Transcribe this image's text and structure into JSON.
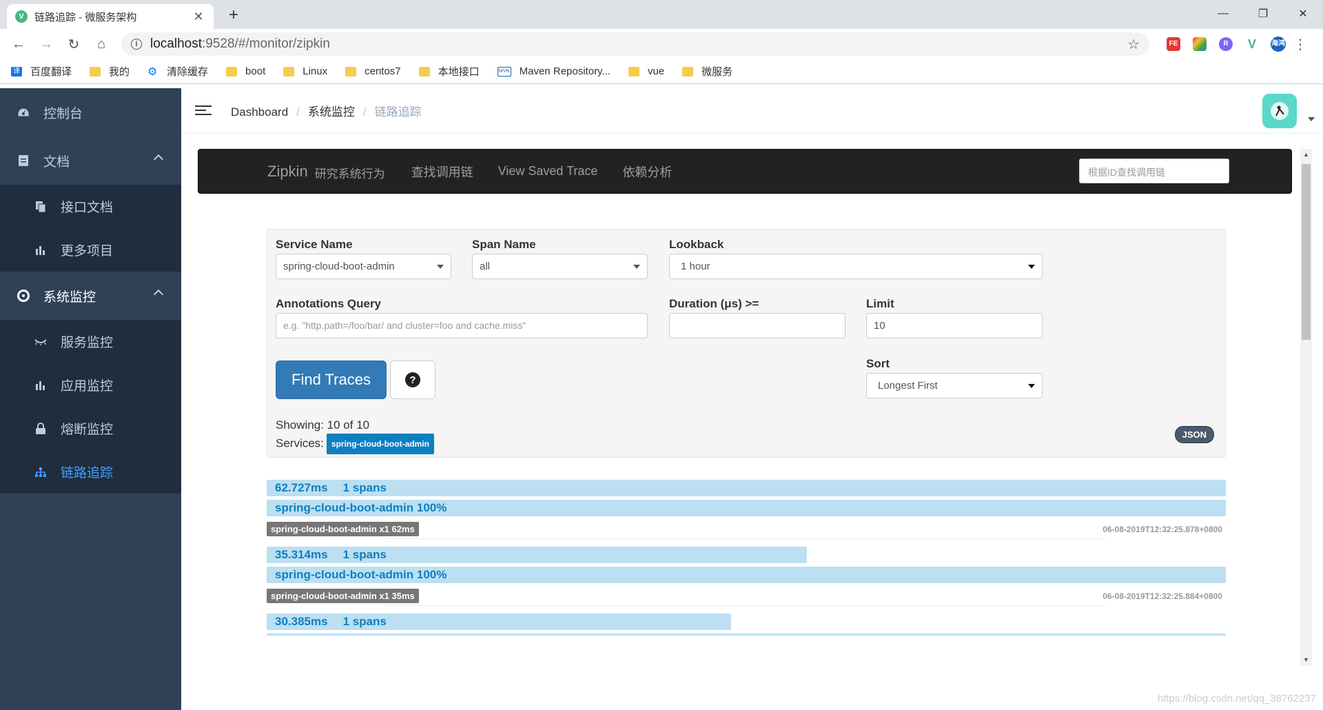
{
  "browser": {
    "tab_title": "链路追踪 - 微服务架构",
    "url_host": "localhost",
    "url_path": ":9528/#/monitor/zipkin",
    "profile": "海鸿",
    "bookmarks": [
      {
        "label": "百度翻译",
        "icon": "translate-icon"
      },
      {
        "label": "我的",
        "icon": "folder-icon"
      },
      {
        "label": "清除缓存",
        "icon": "gear-icon"
      },
      {
        "label": "boot",
        "icon": "folder-icon"
      },
      {
        "label": "Linux",
        "icon": "folder-icon"
      },
      {
        "label": "centos7",
        "icon": "folder-icon"
      },
      {
        "label": "本地接口",
        "icon": "folder-icon"
      },
      {
        "label": "Maven Repository...",
        "icon": "mvn-icon"
      },
      {
        "label": "vue",
        "icon": "folder-icon"
      },
      {
        "label": "微服务",
        "icon": "folder-icon"
      }
    ]
  },
  "sidebar": {
    "items": [
      {
        "label": "控制台",
        "icon": "dashboard-icon"
      },
      {
        "label": "文档",
        "icon": "document-icon",
        "children": [
          {
            "label": "接口文档",
            "icon": "copy-icon"
          },
          {
            "label": "更多项目",
            "icon": "bar-chart-icon"
          }
        ]
      },
      {
        "label": "系统监控",
        "icon": "monitor-icon",
        "children": [
          {
            "label": "服务监控",
            "icon": "eye-icon"
          },
          {
            "label": "应用监控",
            "icon": "bar-chart-icon"
          },
          {
            "label": "熔断监控",
            "icon": "lock-icon"
          },
          {
            "label": "链路追踪",
            "icon": "tree-icon",
            "active": true
          }
        ]
      }
    ]
  },
  "breadcrumb": [
    "Dashboard",
    "系统监控",
    "链路追踪"
  ],
  "zipkin": {
    "brand": "Zipkin",
    "brand_sub": "研究系统行为",
    "nav": [
      "查找调用链",
      "View Saved Trace",
      "依赖分析"
    ],
    "search_placeholder": "根据ID查找调用链",
    "form": {
      "service_name_label": "Service Name",
      "service_name_value": "spring-cloud-boot-admin",
      "span_name_label": "Span Name",
      "span_name_value": "all",
      "lookback_label": "Lookback",
      "lookback_value": "1 hour",
      "annotations_label": "Annotations Query",
      "annotations_placeholder": "e.g. \"http.path=/foo/bar/ and cluster=foo and cache.miss\"",
      "duration_label": "Duration (μs) >=",
      "duration_value": "",
      "limit_label": "Limit",
      "limit_value": "10",
      "sort_label": "Sort",
      "sort_value": "Longest First",
      "find_button": "Find Traces",
      "help_icon": "?"
    },
    "showing_text": "Showing: 10 of 10",
    "services_label": "Services:",
    "services_badge": "spring-cloud-boot-admin",
    "json_badge": "JSON",
    "traces": [
      {
        "duration": "62.727ms",
        "spans": "1 spans",
        "service_pct": "spring-cloud-boot-admin 100%",
        "badge": "spring-cloud-boot-admin x1 62ms",
        "timestamp": "06-08-2019T12:32:25.878+0800",
        "width_fraction": 1.0
      },
      {
        "duration": "35.314ms",
        "spans": "1 spans",
        "service_pct": "spring-cloud-boot-admin 100%",
        "badge": "spring-cloud-boot-admin x1 35ms",
        "timestamp": "06-08-2019T12:32:25.884+0800",
        "width_fraction": 0.563
      },
      {
        "duration": "30.385ms",
        "spans": "1 spans",
        "width_fraction": 0.484
      }
    ]
  },
  "watermark": "https://blog.csdn.net/qq_38762237"
}
